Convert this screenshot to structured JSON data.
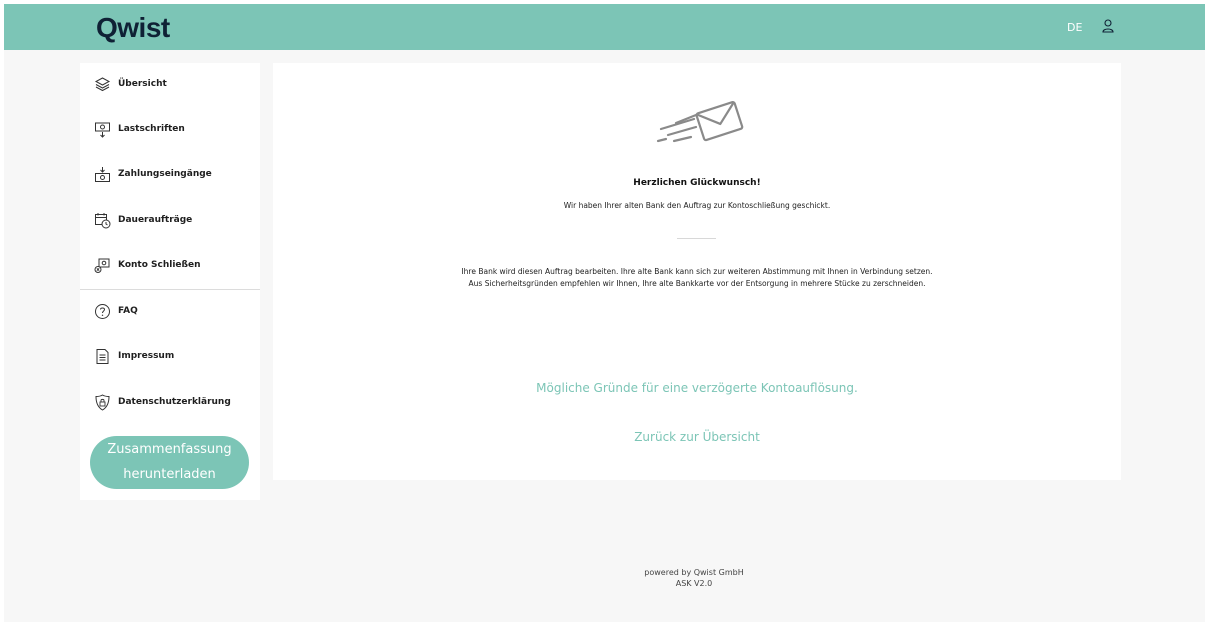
{
  "brand": {
    "logo": "Qwist",
    "accent_color": "#7cc5b6",
    "logo_color": "#0f2135"
  },
  "header": {
    "language": "DE",
    "user_icon": "user-icon"
  },
  "sidebar": {
    "items": [
      {
        "label": "Übersicht",
        "icon": "layers-icon"
      },
      {
        "label": "Lastschriften",
        "icon": "money-out-icon"
      },
      {
        "label": "Zahlungseingänge",
        "icon": "money-in-icon"
      },
      {
        "label": "Daueraufträge",
        "icon": "calendar-clock-icon"
      },
      {
        "label": "Konto Schließen",
        "icon": "close-account-icon"
      },
      {
        "label": "FAQ",
        "icon": "question-icon"
      },
      {
        "label": "Impressum",
        "icon": "document-icon"
      },
      {
        "label": "Datenschutzerklärung",
        "icon": "privacy-lock-icon"
      }
    ],
    "download_button": {
      "line1": "Zusammenfassung",
      "line2": "herunterladen"
    }
  },
  "main": {
    "illustration": "mail-sent-icon",
    "title": "Herzlichen Glückwunsch!",
    "subtitle": "Wir haben Ihrer alten Bank den Auftrag zur Kontoschließung geschickt.",
    "info_line1": "Ihre Bank wird diesen Auftrag bearbeiten. Ihre alte Bank kann sich zur weiteren Abstimmung mit Ihnen in Verbindung setzen.",
    "info_line2": "Aus Sicherheitsgründen empfehlen wir Ihnen, Ihre alte Bankkarte vor der Entsorgung in mehrere Stücke zu zerschneiden.",
    "link_reasons": "Mögliche Gründe für eine verzögerte Kontoauflösung.",
    "link_back": "Zurück zur Übersicht"
  },
  "footer": {
    "powered_by": "powered by Qwist GmbH",
    "version": "ASK V2.0"
  }
}
